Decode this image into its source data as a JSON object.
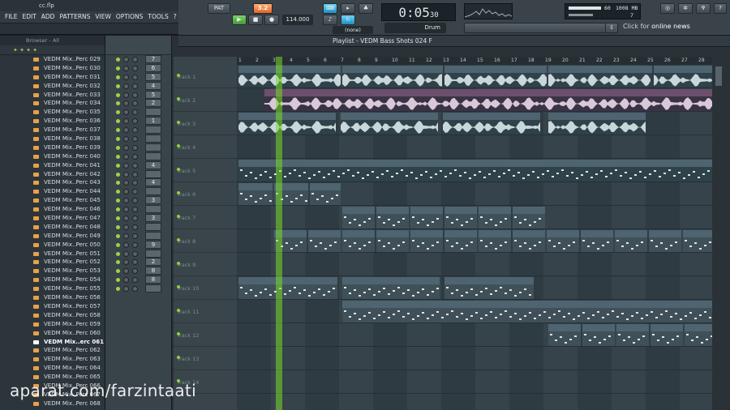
{
  "titlebar": {
    "filename": "cc.flp"
  },
  "menu": [
    "FILE",
    "EDIT",
    "ADD",
    "PATTERNS",
    "VIEW",
    "OPTIONS",
    "TOOLS",
    "?"
  ],
  "toolbar": {
    "pat_song": "PAT",
    "tempo": "114.000",
    "pattern_num": "3.2",
    "time_main": "0:05",
    "time_sub": "30",
    "snap": "Drum",
    "snap_mode": "(none)",
    "cpu_label": "60",
    "mem_label": "1008 MB",
    "poly": "7",
    "news_prefix": "Click for",
    "news_main": "online news"
  },
  "browser": {
    "title": "Browser - All",
    "files": [
      "VEDM Mix..Perc 029",
      "VEDM Mix..Perc 030",
      "VEDM Mix..Perc 031",
      "VEDM Mix..Perc 032",
      "VEDM Mix..Perc 033",
      "VEDM Mix..Perc 034",
      "VEDM Mix..Perc 035",
      "VEDM Mix..Perc 036",
      "VEDM Mix..Perc 037",
      "VEDM Mix..Perc 038",
      "VEDM Mix..Perc 039",
      "VEDM Mix..Perc 040",
      "VEDM Mix..Perc 041",
      "VEDM Mix..Perc 042",
      "VEDM Mix..Perc 043",
      "VEDM Mix..Perc 044",
      "VEDM Mix..Perc 045",
      "VEDM Mix..Perc 046",
      "VEDM Mix..Perc 047",
      "VEDM Mix..Perc 048",
      "VEDM Mix..Perc 049",
      "VEDM Mix..Perc 050",
      "VEDM Mix..Perc 051",
      "VEDM Mix..Perc 052",
      "VEDM Mix..Perc 053",
      "VEDM Mix..Perc 054",
      "VEDM Mix..Perc 055",
      "VEDM Mix..Perc 056",
      "VEDM Mix..Perc 057",
      "VEDM Mix..Perc 058",
      "VEDM Mix..Perc 059",
      "VEDM Mix..Perc 060",
      "VEDM Mix..erc 061",
      "VEDM Mix..Perc 062",
      "VEDM Mix..Perc 063",
      "VEDM Mix..Perc 064",
      "VEDM Mix..Perc 065",
      "VEDM Mix..Perc 066",
      "VEDM Mix..Perc 067",
      "VEDM Mix..Perc 068"
    ],
    "selected_index": 32
  },
  "rack": {
    "numbers": [
      "7",
      "6",
      "5",
      "4",
      "5",
      "2",
      "",
      "1",
      "",
      "",
      "",
      "",
      "4",
      "",
      "4",
      "",
      "3",
      "",
      "3",
      "",
      "",
      "9",
      "",
      "2",
      "8",
      "8",
      ""
    ]
  },
  "playlist": {
    "title": "Playlist - VEDM Bass Shots  024 F",
    "ruler": [
      "1",
      "2",
      "3",
      "4",
      "5",
      "6",
      "7",
      "8",
      "9",
      "10",
      "11",
      "12",
      "13",
      "14",
      "15",
      "16",
      "17",
      "18",
      "19",
      "20",
      "21",
      "22",
      "23",
      "24",
      "25",
      "26",
      "27",
      "28"
    ],
    "tracks": [
      "Track 1",
      "Track 2",
      "Track 3",
      "Track 4",
      "Track 5",
      "Track 6",
      "Track 7",
      "Track 8",
      "Track 9",
      "Track 10",
      "Track 11",
      "Track 12",
      "Track 13",
      "Track 14"
    ],
    "clips": {
      "downlifter_a": "VEDM Downlifter 03",
      "downlifter_b": "VEDM Downlifter 03 - Part_1",
      "vox": "Vox",
      "impact": "VEDM Impact 25 G",
      "pattern1": "Pattern 1",
      "pattern6": "Pattern 6",
      "pattern3": "Pattern 3",
      "pattern3_short": "Pa..n 3",
      "pad": "pad"
    }
  },
  "watermark": "aparat.com/farzintaati"
}
